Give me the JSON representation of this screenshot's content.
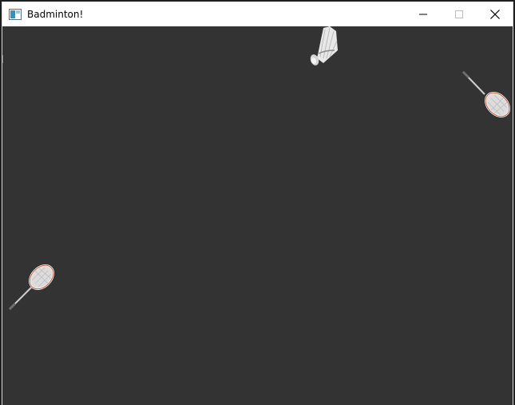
{
  "window": {
    "title": "Badminton!",
    "icon": "app-window-icon",
    "controls": [
      "minimize-icon",
      "maximize-icon",
      "close-icon"
    ]
  },
  "game": {
    "background_color": "#333333",
    "sprites": [
      "shuttlecock",
      "racket-top-right",
      "racket-bottom-left"
    ]
  }
}
